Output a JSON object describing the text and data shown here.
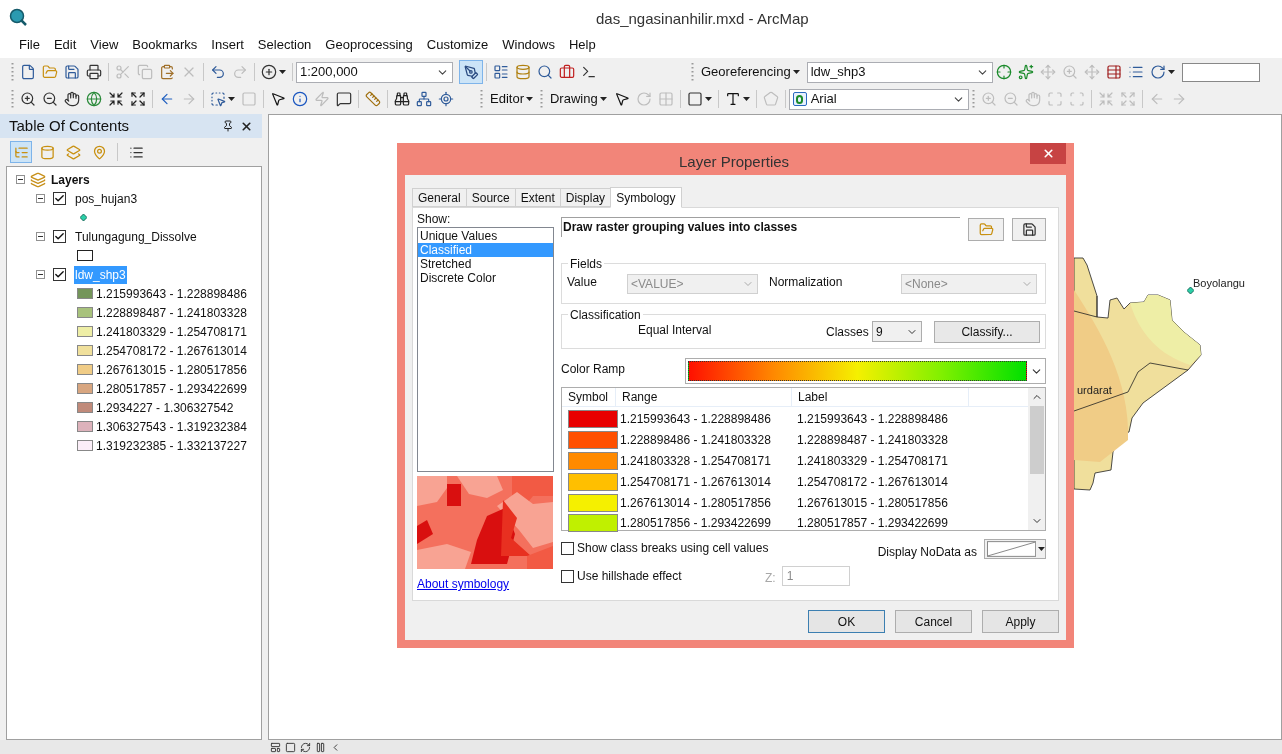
{
  "window": {
    "title": "das_ngasinanhilir.mxd - ArcMap"
  },
  "menu": [
    "File",
    "Edit",
    "View",
    "Bookmarks",
    "Insert",
    "Selection",
    "Geoprocessing",
    "Customize",
    "Windows",
    "Help"
  ],
  "toolbar": {
    "row1a": [
      {
        "disabled": false
      },
      {
        "disabled": false
      },
      {
        "disabled": false
      },
      {
        "disabled": false
      },
      {
        "disabled": true
      },
      {
        "disabled": true
      },
      {
        "disabled": false
      },
      {
        "disabled": true
      },
      {
        "disabled": false
      },
      {
        "disabled": true
      },
      {
        "disabled": false
      }
    ],
    "scale": "1:200,000",
    "editor_tool": {
      "on": true
    },
    "row1b": [
      {
        "disabled": false
      },
      {
        "disabled": false
      },
      {
        "disabled": false
      },
      {
        "disabled": false
      },
      {
        "disabled": false
      }
    ],
    "georeferencing": "Georeferencing",
    "georef_layer": "ldw_shp3",
    "georef_tools": [
      {
        "disabled": false
      },
      {
        "disabled": false
      },
      {
        "disabled": true
      },
      {
        "disabled": true
      },
      {
        "disabled": true
      },
      {
        "disabled": false
      },
      {
        "disabled": false
      },
      {
        "disabled": false
      }
    ],
    "row2a": [
      {
        "disabled": false
      },
      {
        "disabled": false
      },
      {
        "disabled": false
      },
      {
        "disabled": false
      },
      {
        "disabled": false
      },
      {
        "disabled": false
      },
      {
        "disabled": false
      },
      {
        "disabled": true
      },
      {
        "disabled": false
      },
      {
        "disabled": true
      },
      {
        "disabled": false
      },
      {
        "disabled": false
      },
      {
        "disabled": true
      },
      {
        "disabled": false
      },
      {
        "disabled": false
      },
      {
        "disabled": false
      },
      {
        "disabled": false
      },
      {
        "disabled": false
      }
    ],
    "editor": "Editor",
    "drawing": "Drawing",
    "drawing_tools": [
      {
        "disabled": false
      },
      {
        "disabled": true
      },
      {
        "disabled": true
      },
      {
        "disabled": false
      },
      {
        "disabled": false
      },
      {
        "disabled": true
      }
    ],
    "font": "Arial",
    "layout_tools": [
      {
        "disabled": true
      },
      {
        "disabled": true
      },
      {
        "disabled": true
      },
      {
        "disabled": true
      },
      {
        "disabled": true
      },
      {
        "disabled": true
      },
      {
        "disabled": true
      },
      {
        "disabled": true
      },
      {
        "disabled": true
      }
    ]
  },
  "toc": {
    "title": "Table Of Contents",
    "views": [
      {
        "selected": true
      },
      {
        "selected": false
      },
      {
        "selected": false
      },
      {
        "selected": false
      },
      {
        "selected": false
      }
    ],
    "root": {
      "label": "Layers",
      "expanded": true
    },
    "layers": [
      {
        "label": "pos_hujan3",
        "checked": true,
        "expanded": true,
        "selected": false,
        "legend": [
          {
            "kind": "point"
          }
        ]
      },
      {
        "label": "Tulungagung_Dissolve",
        "checked": true,
        "expanded": true,
        "selected": false,
        "legend": [
          {
            "kind": "polygon"
          }
        ]
      },
      {
        "label": "ldw_shp3",
        "checked": true,
        "expanded": true,
        "selected": true,
        "legend": [
          {
            "kind": "class",
            "color": "#74955a",
            "label": "1.215993643 - 1.228898486"
          },
          {
            "kind": "class",
            "color": "#a8c27c",
            "label": "1.228898487 - 1.241803328"
          },
          {
            "kind": "class",
            "color": "#eeeea6",
            "label": "1.241803329 - 1.254708171"
          },
          {
            "kind": "class",
            "color": "#f0e09c",
            "label": "1.254708172 - 1.267613014"
          },
          {
            "kind": "class",
            "color": "#f0cc86",
            "label": "1.267613015 - 1.280517856"
          },
          {
            "kind": "class",
            "color": "#d8a680",
            "label": "1.280517857 - 1.293422699"
          },
          {
            "kind": "class",
            "color": "#c08a7a",
            "label": "1.2934227 - 1.306327542"
          },
          {
            "kind": "class",
            "color": "#ddb2bb",
            "label": "1.306327543 - 1.319232384"
          },
          {
            "kind": "class",
            "color": "#fbeef8",
            "label": "1.319232385 - 1.332137227"
          }
        ]
      }
    ]
  },
  "map": {
    "labels": [
      {
        "text": "Boyolangu"
      },
      {
        "text": "urdarat"
      }
    ]
  },
  "dialog": {
    "title": "Layer Properties",
    "tabs": [
      {
        "label": "General",
        "selected": false
      },
      {
        "label": "Source",
        "selected": false
      },
      {
        "label": "Extent",
        "selected": false
      },
      {
        "label": "Display",
        "selected": false
      },
      {
        "label": "Symbology",
        "selected": true
      }
    ],
    "show_label": "Show:",
    "show_items": [
      {
        "label": "Unique Values",
        "selected": false
      },
      {
        "label": "Classified",
        "selected": true
      },
      {
        "label": "Stretched",
        "selected": false
      },
      {
        "label": "Discrete Color",
        "selected": false
      }
    ],
    "link": "About symbology",
    "heading": "Draw raster grouping values into classes",
    "fields_group": "Fields",
    "value_label": "Value",
    "value": "<VALUE>",
    "normalization_label": "Normalization",
    "normalization": "<None>",
    "classification_group": "Classification",
    "method": "Equal Interval",
    "classes_label": "Classes",
    "classes": "9",
    "classify_button": "Classify...",
    "color_ramp_label": "Color Ramp",
    "columns": [
      "Symbol",
      "Range",
      "Label"
    ],
    "rows": [
      {
        "color": "#e80000",
        "range": "1.215993643 - 1.228898486",
        "label": "1.215993643 - 1.228898486"
      },
      {
        "color": "#ff5000",
        "range": "1.228898486 - 1.241803328",
        "label": "1.228898487 - 1.241803328"
      },
      {
        "color": "#ff8a00",
        "range": "1.241803328 - 1.254708171",
        "label": "1.241803329 - 1.254708171"
      },
      {
        "color": "#ffbf00",
        "range": "1.254708171 - 1.267613014",
        "label": "1.254708172 - 1.267613014"
      },
      {
        "color": "#f5f000",
        "range": "1.267613014 - 1.280517856",
        "label": "1.267613015 - 1.280517856"
      },
      {
        "color": "#c0f000",
        "range": "1.280517856 - 1.293422699",
        "label": "1.280517857 - 1.293422699"
      }
    ],
    "show_breaks": {
      "label": "Show class breaks using cell values",
      "checked": false
    },
    "hillshade": {
      "label": "Use hillshade effect",
      "checked": false
    },
    "z_label": "Z:",
    "z_value": "1",
    "nodata_label": "Display NoData as",
    "buttons": [
      {
        "label": "OK",
        "default": true
      },
      {
        "label": "Cancel",
        "default": false
      },
      {
        "label": "Apply",
        "default": false
      }
    ]
  }
}
